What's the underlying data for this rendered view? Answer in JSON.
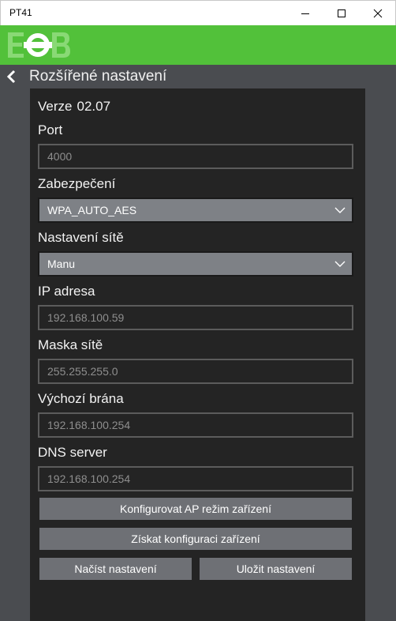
{
  "window": {
    "title": "PT41"
  },
  "colors": {
    "brand_green": "#52c13a",
    "panel_bg": "#242424",
    "app_bg": "#4a4c50",
    "button_bg": "#6e7075",
    "select_bg": "#7e8186"
  },
  "nav": {
    "title": "Rozšířené nastavení",
    "back_icon": "chevron-left-icon"
  },
  "form": {
    "version_label": "Verze",
    "version_value": "02.07",
    "port_label": "Port",
    "port_placeholder": "4000",
    "security_label": "Zabezpečení",
    "security_value": "WPA_AUTO_AES",
    "network_label": "Nastavení sítě",
    "network_value": "Manu",
    "ip_label": "IP adresa",
    "ip_placeholder": "192.168.100.59",
    "mask_label": "Maska sítě",
    "mask_placeholder": "255.255.255.0",
    "gateway_label": "Výchozí brána",
    "gateway_placeholder": "192.168.100.254",
    "dns_label": "DNS server",
    "dns_placeholder": "192.168.100.254"
  },
  "buttons": {
    "configure_ap": "Konfigurovat AP režim zařízení",
    "get_config": "Získat konfiguraci zařízení",
    "load_settings": "Načíst nastavení",
    "save_settings": "Uložit nastavení"
  }
}
